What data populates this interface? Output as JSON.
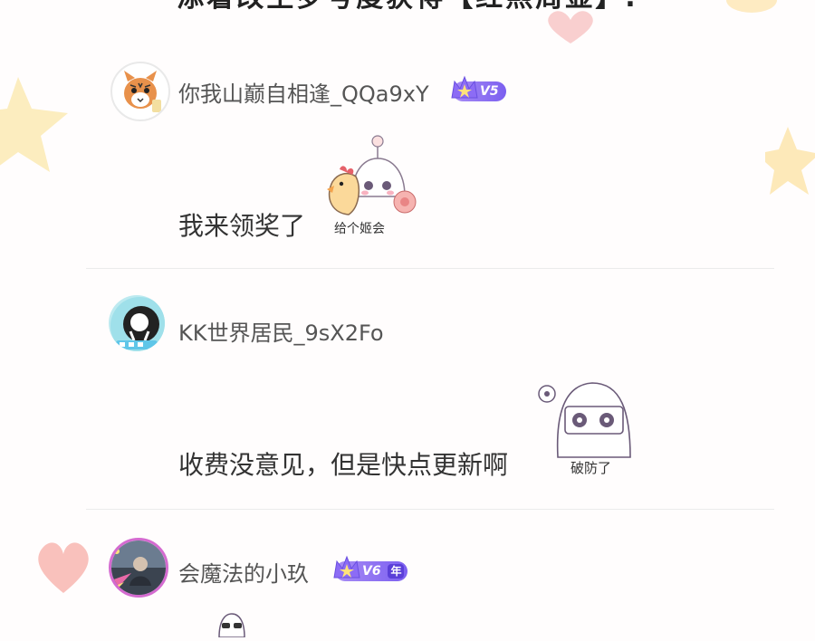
{
  "banner": {
    "text": "添着改生罗号度获得【红熙周显】."
  },
  "comments": [
    {
      "username": "你我山巅自相逢_QQa9xY",
      "vip_level": "V5",
      "text": "我来领奖了",
      "sticker_text": "给个姬会",
      "avatar": "tiger-avatar"
    },
    {
      "username": "KK世界居民_9sX2Fo",
      "vip_level": "",
      "text": "收费没意见，但是快点更新啊",
      "sticker_text": "破防了",
      "avatar": "white-figure-avatar"
    },
    {
      "username": "会魔法的小玖",
      "vip_level": "V6",
      "vip_year": "年",
      "text": "",
      "avatar": "photo-avatar"
    }
  ],
  "colors": {
    "vip_purple": "#7b5ff0",
    "username_gray": "#555555",
    "divider": "#ebebeb"
  }
}
